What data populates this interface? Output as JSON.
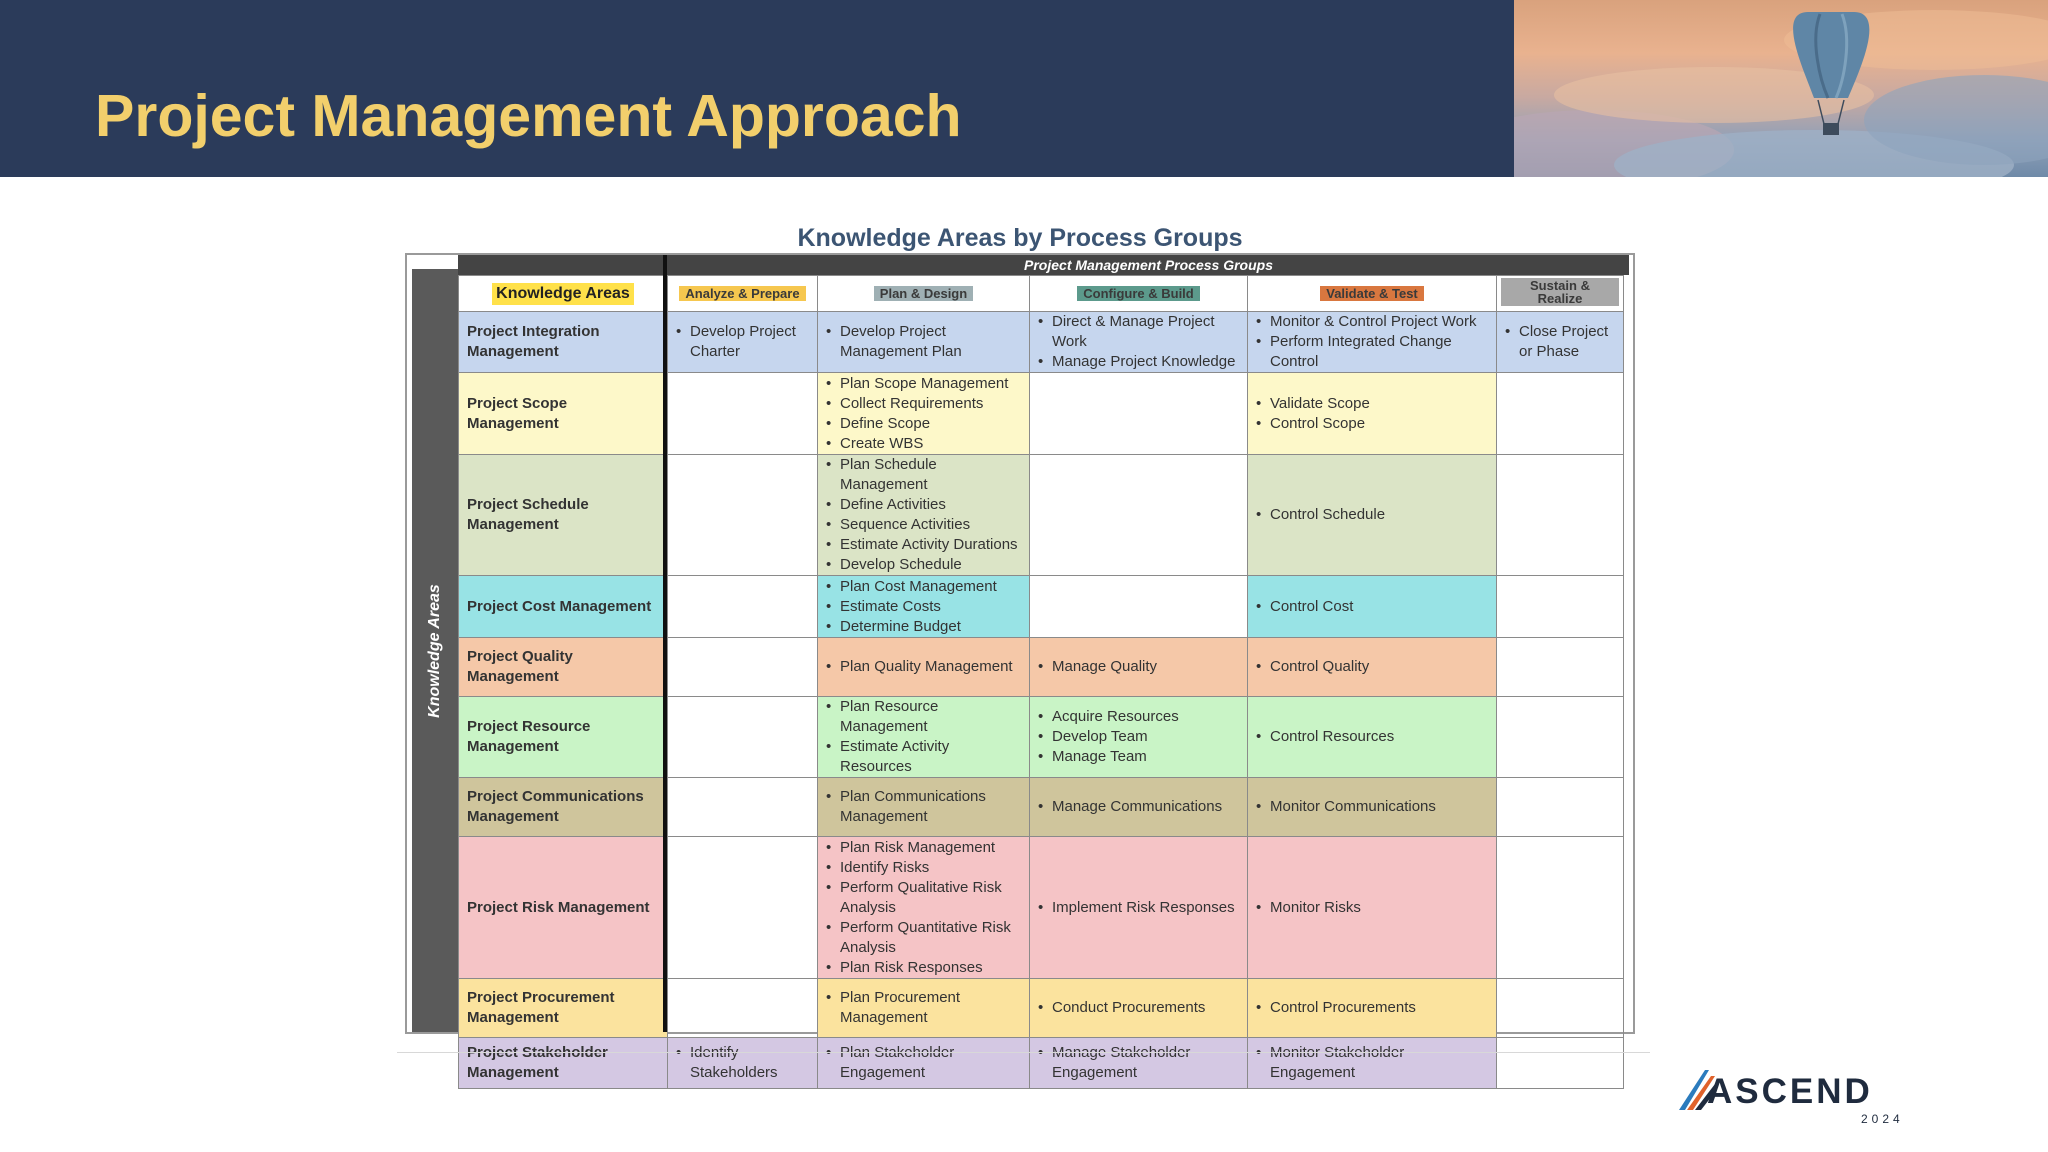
{
  "slide": {
    "title": "Project Management Approach"
  },
  "figure": {
    "title": "Knowledge Areas by Process Groups",
    "group_label": "Project Management Process Groups",
    "side_label": "Knowledge Areas"
  },
  "columns": [
    {
      "label": "Knowledge Areas",
      "color": "#ffe14a"
    },
    {
      "label": "Analyze & Prepare",
      "color": "#f6c74f"
    },
    {
      "label": "Plan & Design",
      "color": "#9fb0b4"
    },
    {
      "label": "Configure & Build",
      "color": "#5c9a8c"
    },
    {
      "label": "Validate & Test",
      "color": "#d9773f"
    },
    {
      "label": "Sustain & Realize",
      "color": "#a8a8a8"
    }
  ],
  "rows": [
    {
      "name": "Project Integration Management",
      "color": "#c6d6ee",
      "analyze": [
        "Develop Project Charter"
      ],
      "plan": [
        "Develop Project Management Plan"
      ],
      "configure": [
        "Direct & Manage Project Work",
        "Manage Project Knowledge"
      ],
      "validate": [
        "Monitor & Control Project Work",
        "Perform Integrated Change Control"
      ],
      "sustain": [
        "Close Project or Phase"
      ]
    },
    {
      "name": "Project Scope Management",
      "color": "#fdf8c9",
      "analyze": [],
      "plan": [
        "Plan Scope Management",
        "Collect Requirements",
        "Define Scope",
        "Create WBS"
      ],
      "configure": [],
      "validate": [
        "Validate Scope",
        "Control Scope"
      ],
      "sustain": []
    },
    {
      "name": "Project Schedule Management",
      "color": "#dbe4c6",
      "analyze": [],
      "plan": [
        "Plan Schedule Management",
        "Define Activities",
        "Sequence Activities",
        "Estimate Activity Durations",
        "Develop Schedule"
      ],
      "configure": [],
      "validate": [
        "Control Schedule"
      ],
      "sustain": []
    },
    {
      "name": "Project Cost Management",
      "color": "#98e3e5",
      "analyze": [],
      "plan": [
        "Plan Cost Management",
        "Estimate Costs",
        "Determine Budget"
      ],
      "configure": [],
      "validate": [
        "Control Cost"
      ],
      "sustain": []
    },
    {
      "name": "Project Quality Management",
      "color": "#f5c8a8",
      "analyze": [],
      "plan": [
        "Plan Quality Management"
      ],
      "configure": [
        "Manage Quality"
      ],
      "validate": [
        "Control Quality"
      ],
      "sustain": []
    },
    {
      "name": "Project Resource Management",
      "color": "#c9f4c6",
      "analyze": [],
      "plan": [
        "Plan Resource Management",
        "Estimate Activity Resources"
      ],
      "configure": [
        "Acquire Resources",
        "Develop Team",
        "Manage Team"
      ],
      "validate": [
        "Control Resources"
      ],
      "sustain": []
    },
    {
      "name": "Project Communications Management",
      "color": "#cfc59c",
      "analyze": [],
      "plan": [
        "Plan Communications Management"
      ],
      "configure": [
        "Manage Communications"
      ],
      "validate": [
        "Monitor Communications"
      ],
      "sustain": []
    },
    {
      "name": "Project Risk Management",
      "color": "#f5c4c6",
      "analyze": [],
      "plan": [
        "Plan Risk Management",
        "Identify Risks",
        "Perform Qualitative Risk Analysis",
        "Perform Quantitative Risk Analysis",
        "Plan Risk Responses"
      ],
      "configure": [
        "Implement Risk Responses"
      ],
      "validate": [
        "Monitor Risks"
      ],
      "sustain": []
    },
    {
      "name": "Project Procurement Management",
      "color": "#fbe39e",
      "analyze": [],
      "plan": [
        "Plan Procurement Management"
      ],
      "configure": [
        "Conduct Procurements"
      ],
      "validate": [
        "Control Procurements"
      ],
      "sustain": []
    },
    {
      "name": "Project Stakeholder Management",
      "color": "#d4c8e3",
      "analyze": [
        "Identify Stakeholders"
      ],
      "plan": [
        "Plan Stakeholder Engagement"
      ],
      "configure": [
        "Manage Stakeholder Engagement"
      ],
      "validate": [
        "Monitor Stakeholder Engagement"
      ],
      "sustain": []
    }
  ],
  "logo": {
    "word": "ASCEND",
    "year": "2024",
    "accent_colors": [
      "#2b7bbd",
      "#e0622b"
    ]
  }
}
